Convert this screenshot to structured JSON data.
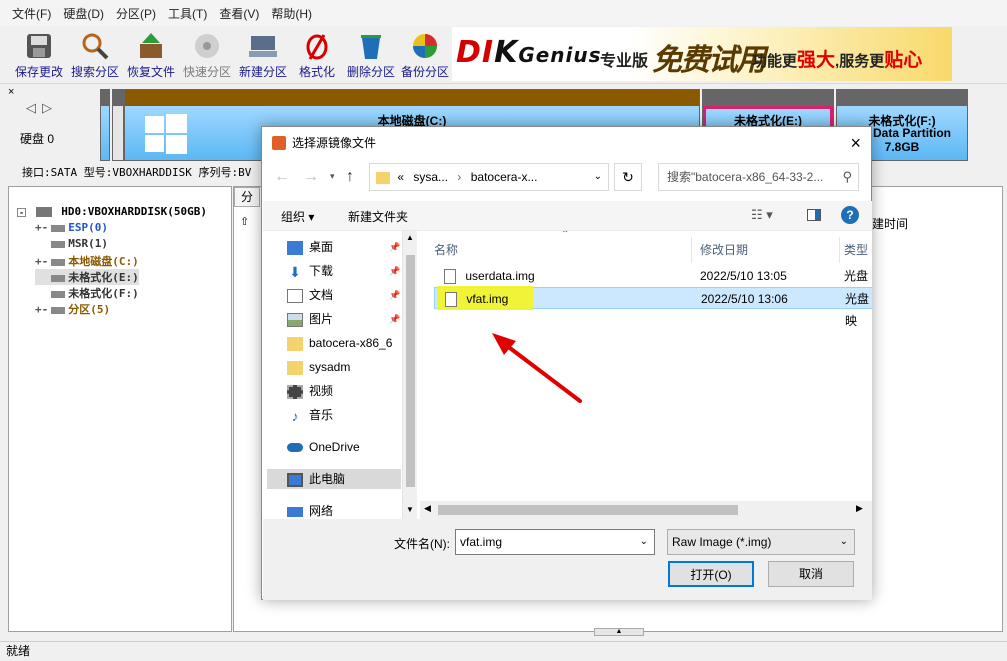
{
  "menu": [
    "文件(F)",
    "硬盘(D)",
    "分区(P)",
    "工具(T)",
    "查看(V)",
    "帮助(H)"
  ],
  "toolbar": [
    {
      "label": "保存更改",
      "icon": "save-icon"
    },
    {
      "label": "搜索分区",
      "icon": "search-partition-icon"
    },
    {
      "label": "恢复文件",
      "icon": "recover-files-icon"
    },
    {
      "label": "快速分区",
      "icon": "quick-partition-icon"
    },
    {
      "label": "新建分区",
      "icon": "new-partition-icon"
    },
    {
      "label": "格式化",
      "icon": "format-icon"
    },
    {
      "label": "删除分区",
      "icon": "delete-partition-icon"
    },
    {
      "label": "备份分区",
      "icon": "backup-partition-icon"
    }
  ],
  "banner": {
    "logo_a": "DI",
    "logo_b": "K",
    "logo_c": "Genius",
    "edition": "专业版",
    "free": "免费试用",
    "slogan_a": "功能更",
    "slogan_b": "强大",
    "slogan_c": ",服务更",
    "slogan_d": "贴心"
  },
  "disk_panel": {
    "label": "硬盘 0"
  },
  "partitions": [
    {
      "label": "本地磁盘(C:)"
    },
    {
      "label": "未格式化(E:)"
    },
    {
      "label": "未格式化(F:)",
      "sub": "sic Data Partition",
      "size": "7.8GB"
    }
  ],
  "disk_info": "接口:SATA  型号:VBOXHARDDISK  序列号:BV",
  "tree": {
    "root": "HD0:VBOXHARDDISK(50GB)",
    "items": [
      {
        "label": "ESP(0)",
        "color": "#2255cc"
      },
      {
        "label": "MSR(1)",
        "color": "#333333"
      },
      {
        "label": "本地磁盘(C:)",
        "color": "#8a5a00"
      },
      {
        "label": "未格式化(E:)",
        "color": "#333333"
      },
      {
        "label": "未格式化(F:)",
        "color": "#333333"
      },
      {
        "label": "分区(5)",
        "color": "#8a5a00"
      }
    ]
  },
  "right_pane": {
    "tab": "分",
    "col_created": "建时间"
  },
  "status": "就绪",
  "dialog": {
    "title": "选择源镜像文件",
    "address": {
      "prefix": "«",
      "seg1": "sysa...",
      "seg2": "batocera-x..."
    },
    "search_placeholder": "搜索\"batocera-x86_64-33-2...",
    "organize": "组织",
    "new_folder": "新建文件夹",
    "nav": [
      "桌面",
      "下载",
      "文档",
      "图片",
      "batocera-x86_6",
      "sysadm",
      "视频",
      "音乐",
      "OneDrive",
      "此电脑",
      "网络"
    ],
    "columns": {
      "name": "名称",
      "modified": "修改日期",
      "type": "类型"
    },
    "files": [
      {
        "name": "userdata.img",
        "modified": "2022/5/10 13:05",
        "type": "光盘映"
      },
      {
        "name": "vfat.img",
        "modified": "2022/5/10 13:06",
        "type": "光盘映"
      }
    ],
    "filename_label": "文件名(N):",
    "filename_value": "vfat.img",
    "filter": "Raw Image (*.img)",
    "open_button": "打开(O)",
    "cancel_button": "取消"
  }
}
